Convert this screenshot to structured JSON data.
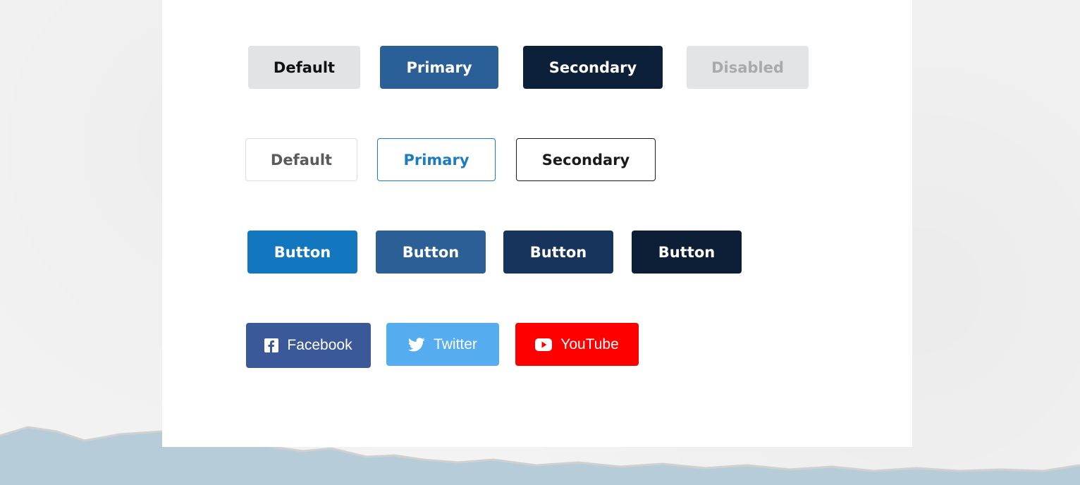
{
  "row_solid": {
    "default": "Default",
    "primary": "Primary",
    "secondary": "Secondary",
    "disabled": "Disabled"
  },
  "row_outline": {
    "default": "Default",
    "primary": "Primary",
    "secondary": "Secondary"
  },
  "row_shades": {
    "labels": [
      "Button",
      "Button",
      "Button",
      "Button"
    ]
  },
  "row_social": {
    "facebook": "Facebook",
    "twitter": "Twitter",
    "youtube": "YouTube"
  },
  "colors": {
    "primary": "#2a5f97",
    "secondary": "#0c2039",
    "outline_primary": "#1d7bbf",
    "facebook": "#3b5998",
    "twitter": "#55acee",
    "youtube": "#ff0000",
    "water": "#b6cdd9"
  },
  "icons": {
    "facebook": "facebook-icon",
    "twitter": "twitter-icon",
    "youtube": "youtube-icon"
  }
}
